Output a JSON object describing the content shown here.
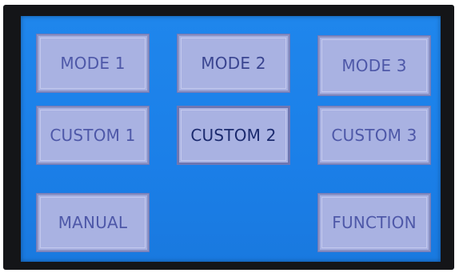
{
  "panel": {
    "buttons": {
      "mode_1": "MODE 1",
      "mode_2": "MODE 2",
      "mode_3": "MODE 3",
      "custom_1": "CUSTOM 1",
      "custom_2": "CUSTOM 2",
      "custom_3": "CUSTOM 3",
      "manual": "MANUAL",
      "function": "FUNCTION"
    },
    "selected": "custom_2"
  },
  "colors": {
    "screen_background": "#1b7fe8",
    "button_fill": "#a9b2e2",
    "button_text": "#4e58a8",
    "button_text_selected": "#1b2a6e",
    "bezel": "#141518"
  }
}
